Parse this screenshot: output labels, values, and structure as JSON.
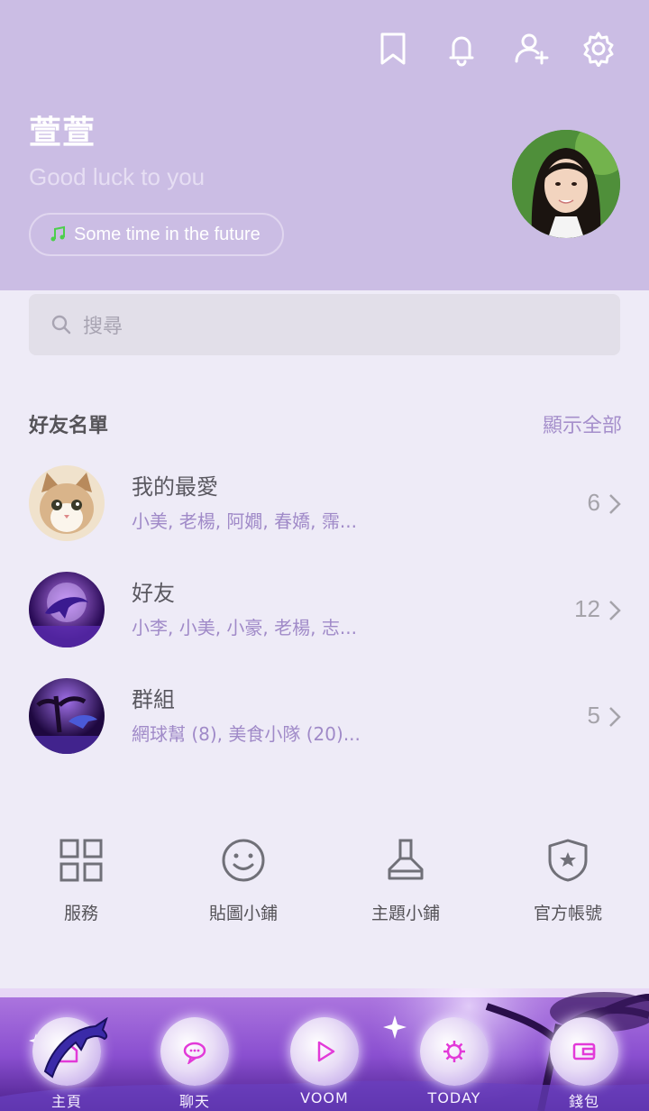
{
  "header": {
    "name": "萱萱",
    "status_message": "Good luck to you",
    "music": "Some time in the future",
    "icons": [
      "bookmark-icon",
      "bell-icon",
      "add-friend-icon",
      "gear-icon"
    ]
  },
  "search": {
    "placeholder": "搜尋"
  },
  "friends": {
    "title": "好友名單",
    "show_all": "顯示全部",
    "groups": [
      {
        "title": "我的最愛",
        "members": "小美, 老楊, 阿嫺, 春嬌, 霈...",
        "count": "6"
      },
      {
        "title": "好友",
        "members": "小李, 小美, 小豪, 老楊, 志...",
        "count": "12"
      },
      {
        "title": "群組",
        "members": "網球幫 (8), 美食小隊 (20)...",
        "count": "5"
      }
    ]
  },
  "services": [
    {
      "label": "服務",
      "icon": "grid-icon"
    },
    {
      "label": "貼圖小鋪",
      "icon": "smiley-icon"
    },
    {
      "label": "主題小鋪",
      "icon": "brush-icon"
    },
    {
      "label": "官方帳號",
      "icon": "shield-star-icon"
    }
  ],
  "tabs": [
    {
      "label": "主頁",
      "icon": "home-icon"
    },
    {
      "label": "聊天",
      "icon": "chat-icon"
    },
    {
      "label": "VOOM",
      "icon": "play-icon"
    },
    {
      "label": "TODAY",
      "icon": "today-icon"
    },
    {
      "label": "錢包",
      "icon": "wallet-icon"
    }
  ],
  "colors": {
    "header_bg": "#cbbde4",
    "accent": "#a58fcb",
    "body_bg": "#eeebf7",
    "tab_icon": "#e23ad8"
  }
}
